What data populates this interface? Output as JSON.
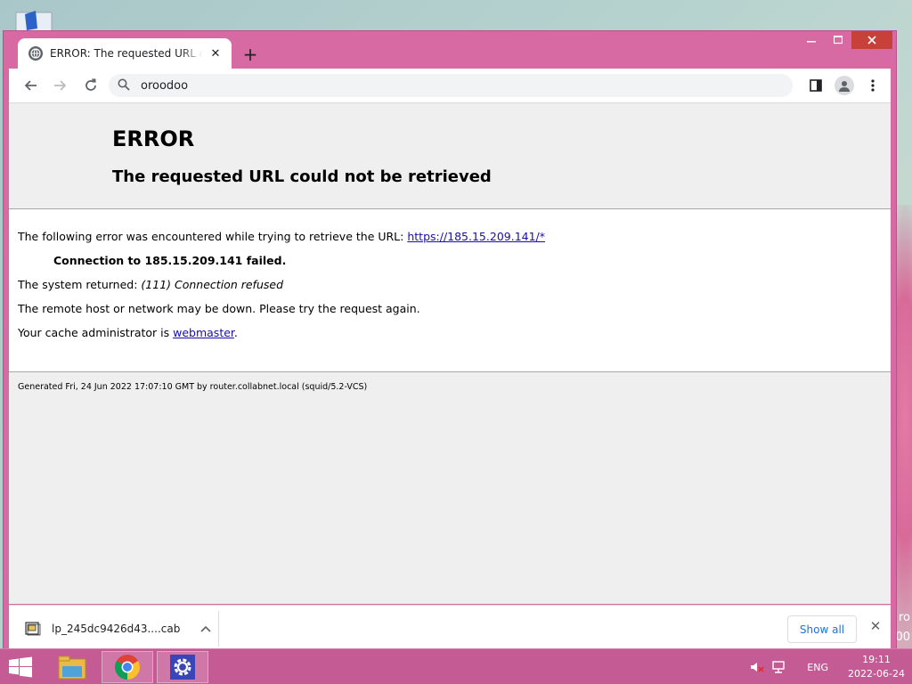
{
  "desktop": {
    "wallpaper_text_1": "ro",
    "wallpaper_text_2": "00"
  },
  "window": {
    "controls": {
      "minimize_icon": "minimize-icon",
      "maximize_icon": "maximize-icon",
      "close_icon": "close-icon"
    }
  },
  "tabs": [
    {
      "title": "ERROR: The requested URL could not be retrieved",
      "favicon": "globe-icon",
      "active": true
    }
  ],
  "toolbar": {
    "omnibox_text": "oroodoo",
    "icons": [
      "back-arrow-icon",
      "forward-arrow-icon",
      "reload-icon",
      "search-icon",
      "side-panel-icon",
      "profile-icon",
      "menu-icon"
    ]
  },
  "page": {
    "heading": "ERROR",
    "subheading": "The requested URL could not be retrieved",
    "line1_prefix": "The following error was encountered while trying to retrieve the URL: ",
    "line1_link": "https://185.15.209.141/*",
    "connection_failed": "Connection to 185.15.209.141 failed.",
    "system_returned_prefix": "The system returned: ",
    "system_returned_value": "(111) Connection refused",
    "remote_host": "The remote host or network may be down. Please try the request again.",
    "cache_admin_prefix": "Your cache administrator is ",
    "cache_admin_link": "webmaster",
    "cache_admin_suffix": ".",
    "footer": "Generated Fri, 24 Jun 2022 17:07:10 GMT by router.collabnet.local (squid/5.2-VCS)"
  },
  "download_shelf": {
    "file_name": "lp_245dc9426d43....cab",
    "show_all_label": "Show all"
  },
  "taskbar": {
    "apps": [
      "file-explorer-icon",
      "chrome-icon",
      "settings-icon"
    ],
    "language": "ENG",
    "time": "19:11",
    "date": "2022-06-24"
  },
  "colors": {
    "window_frame": "#d76aa2",
    "taskbar": "#c55b95",
    "link": "#1a0dab",
    "show_all_text": "#1a73e8"
  }
}
